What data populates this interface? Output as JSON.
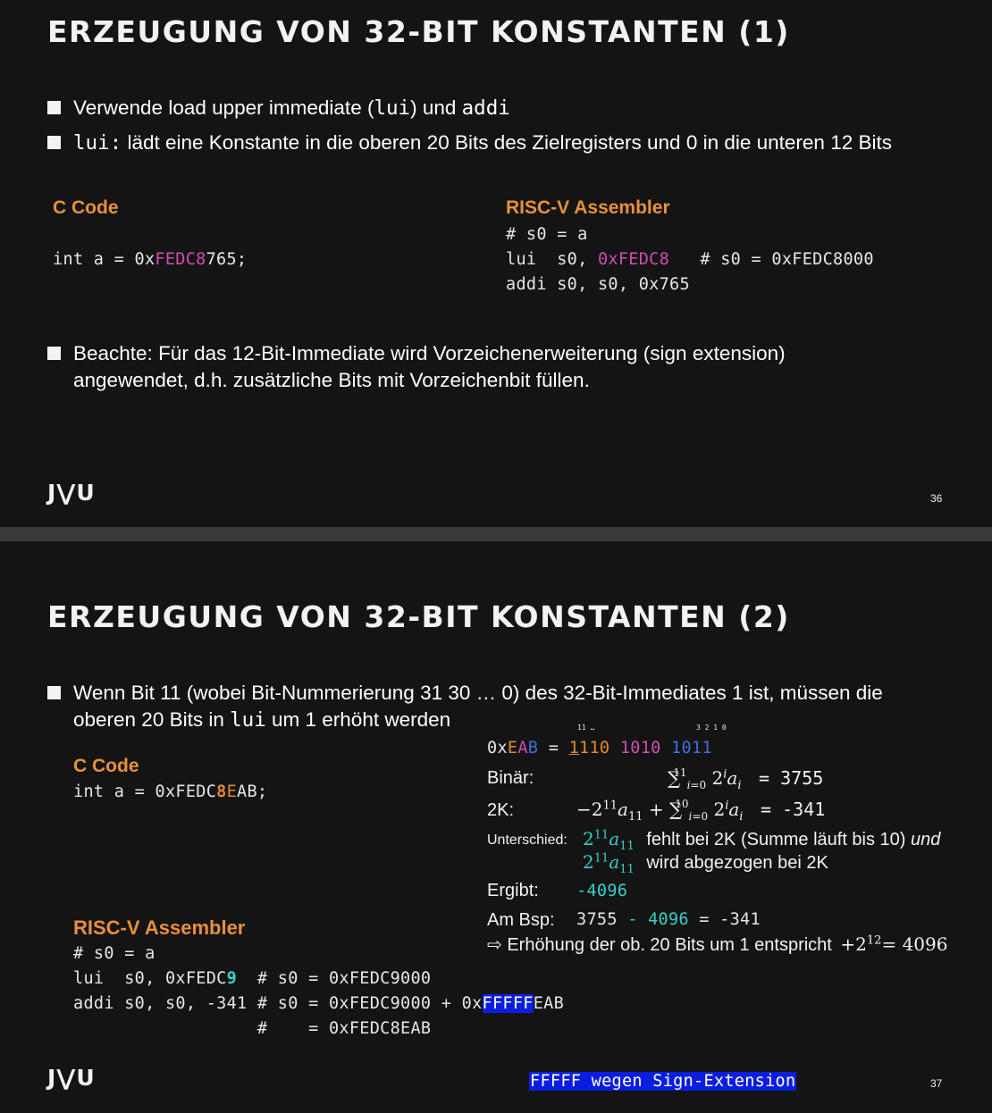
{
  "slide1": {
    "title": "ERZEUGUNG VON 32-BIT KONSTANTEN (1)",
    "bullet1": {
      "t1": "Verwende load upper immediate (",
      "c1": "lui",
      "t2": ") und ",
      "c2": "addi"
    },
    "bullet2": {
      "c1": "lui:",
      "t1": " lädt eine Konstante in die oberen 20 Bits des Zielregisters und 0 in die unteren 12 Bits"
    },
    "c_heading": "C Code",
    "c_line": {
      "pre": "int a = 0x",
      "hi": "FEDC8",
      "post": "765;"
    },
    "asm_heading": "RISC-V Assembler",
    "asm": {
      "l1": "# s0 = a",
      "l2_pre": "lui  s0, ",
      "l2_hi": "0xFEDC8",
      "l2_post": "   # s0 = 0xFEDC8000",
      "l3": "addi s0, s0, 0x765"
    },
    "bullet3": {
      "line1": "Beachte: Für das 12-Bit-Immediate wird Vorzeichenerweiterung (sign extension)",
      "line2": "angewendet, d.h. zusätzliche Bits mit Vorzeichenbit füllen."
    },
    "logo": "J⋁U",
    "page": "36"
  },
  "slide2": {
    "title": "ERZEUGUNG VON 32-BIT KONSTANTEN (2)",
    "bullet1": {
      "line1": "Wenn Bit 11 (wobei Bit-Nummerierung 31 30 … 0) des 32-Bit-Immediates 1 ist, müssen die",
      "l2a": "oberen 20 Bits in ",
      "l2c": "lui",
      "l2b": " um 1 erhöht werden"
    },
    "c_heading": "C Code",
    "c_line": {
      "pre": "int a = 0xFEDC",
      "b8": "8",
      "e": "E",
      "post": "AB;"
    },
    "bit_index_left": "11 …",
    "bit_index_right": "3 2 1 0",
    "hex": {
      "pre": "0x",
      "e": "E",
      "a": "A",
      "b": "B",
      "eq": " = ",
      "n1_first": "1",
      "n1_rest": "110",
      "n2": "1010",
      "n3": "1011"
    },
    "binaer_label": "Binär:",
    "binaer_result": "3755",
    "zk_label": "2K:",
    "zk_result": "-341",
    "unterschied_label": "Unterschied:",
    "unterschied_t1": "fehlt bei 2K (Summe läuft bis 10)",
    "unterschied_und": "und",
    "unterschied_t2": "wird abgezogen bei 2K",
    "ergibt_label": "Ergibt:",
    "ergibt_value": "-4096",
    "bsp_label": "Am Bsp:",
    "bsp": {
      "a": "3755",
      "minus": " - ",
      "b": "4096",
      "rest": " = -341"
    },
    "erhoehung": "⇨ Erhöhung der ob. 20 Bits um 1 entspricht",
    "erhoehung_result": "= 4096",
    "asm_heading": "RISC-V Assembler",
    "asm": {
      "l1": "# s0 = a",
      "l2_pre": "lui  s0, 0xFEDC",
      "l2_b": "9",
      "l2_post": "  # s0 = 0xFEDC9000",
      "l3_pre": "addi s0, s0, -341 # s0 = 0xFEDC9000 + 0x",
      "l3_hl": "FFFFF",
      "l3_post": "EAB",
      "l4": "                  #    = 0xFEDC8EAB"
    },
    "note": "FFFFF wegen Sign-Extension",
    "logo": "J⋁U",
    "page": "37"
  }
}
